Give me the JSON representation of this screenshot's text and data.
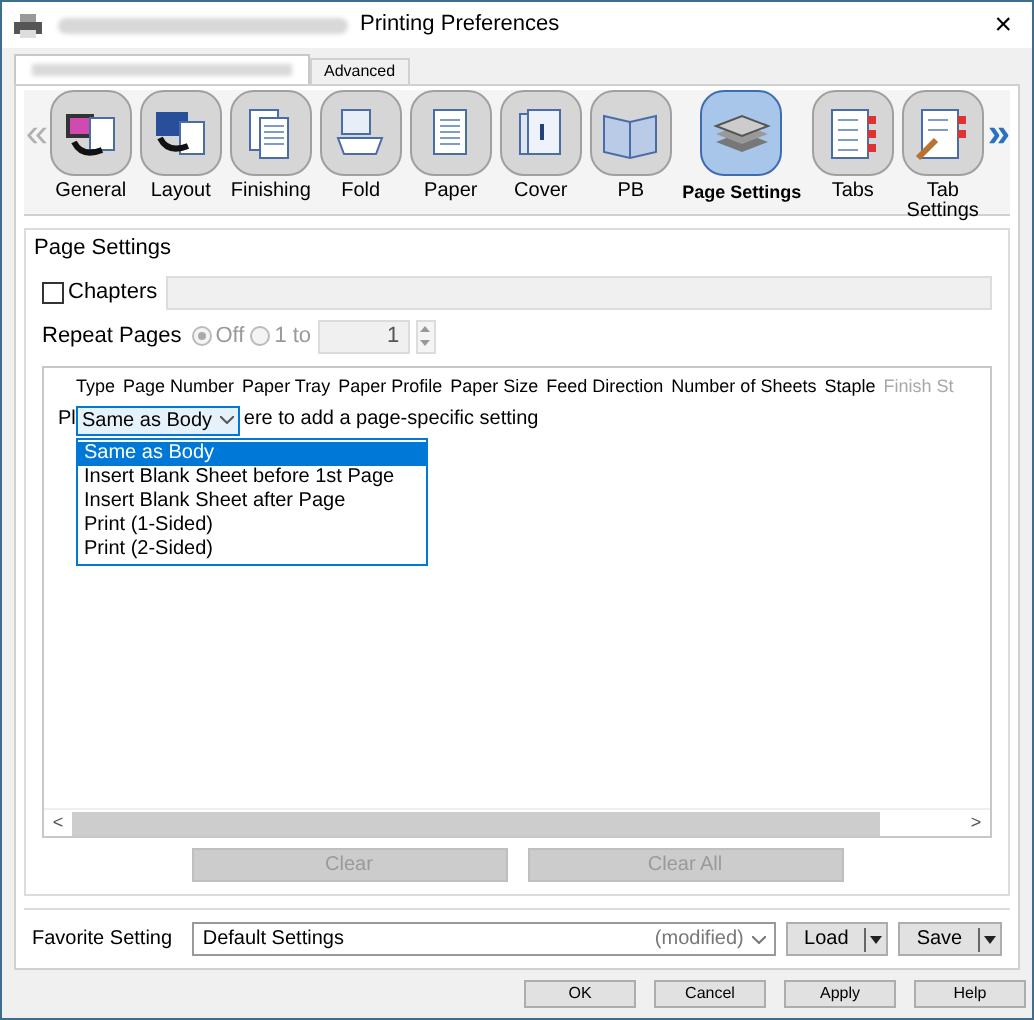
{
  "window": {
    "title": "Printing Preferences",
    "close": "×"
  },
  "tabs": [
    {
      "kind": "redacted",
      "selected": true
    },
    {
      "kind": "text",
      "label": "Advanced",
      "selected": false
    }
  ],
  "toolbar": {
    "prev": "«",
    "next": "»",
    "items": [
      {
        "label": "General",
        "selected": false
      },
      {
        "label": "Layout",
        "selected": false
      },
      {
        "label": "Finishing",
        "selected": false
      },
      {
        "label": "Fold",
        "selected": false
      },
      {
        "label": "Paper",
        "selected": false
      },
      {
        "label": "Cover",
        "selected": false
      },
      {
        "label": "PB",
        "selected": false
      },
      {
        "label": "Page Settings",
        "selected": true
      },
      {
        "label": "Tabs",
        "selected": false
      },
      {
        "label": "Tab Settings",
        "selected": false
      }
    ]
  },
  "group": {
    "title": "Page Settings",
    "chapters": {
      "label": "Chapters",
      "checked": false
    },
    "repeat": {
      "label": "Repeat Pages",
      "options": [
        {
          "label": "Off",
          "selected": true
        },
        {
          "label": "1 to",
          "selected": false
        }
      ],
      "disabled": true,
      "value": "1"
    },
    "table": {
      "columns": [
        {
          "label": "Type",
          "disabled": false
        },
        {
          "label": "Page Number",
          "disabled": false
        },
        {
          "label": "Paper Tray",
          "disabled": false
        },
        {
          "label": "Paper Profile",
          "disabled": false
        },
        {
          "label": "Paper Size",
          "disabled": false
        },
        {
          "label": "Feed Direction",
          "disabled": false
        },
        {
          "label": "Number of Sheets",
          "disabled": false
        },
        {
          "label": "Staple",
          "disabled": false
        },
        {
          "label": "Finish St",
          "disabled": true
        }
      ],
      "hint_start": "Pl",
      "hint_end": "ere to add a page-specific setting",
      "dropdown": {
        "value": "Same as Body",
        "options": [
          {
            "label": "Same as Body",
            "selected": true
          },
          {
            "label": "Insert Blank Sheet before 1st Page",
            "selected": false
          },
          {
            "label": "Insert Blank Sheet after Page",
            "selected": false
          },
          {
            "label": "Print (1-Sided)",
            "selected": false
          },
          {
            "label": "Print (2-Sided)",
            "selected": false
          }
        ]
      },
      "scroll_left": "<",
      "scroll_right": ">"
    },
    "buttons": [
      {
        "label": "Clear",
        "disabled": true
      },
      {
        "label": "Clear All",
        "disabled": true
      }
    ]
  },
  "favorite": {
    "label": "Favorite Setting",
    "value": "Default Settings",
    "status": "(modified)",
    "buttons": [
      "Load",
      "Save"
    ]
  },
  "footer_buttons": [
    "OK",
    "Cancel",
    "Apply",
    "Help"
  ]
}
